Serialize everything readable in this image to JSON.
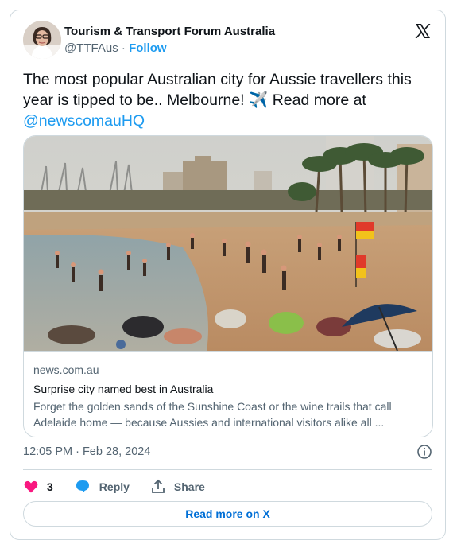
{
  "author": {
    "name": "Tourism & Transport Forum Australia",
    "handle": "@TTFAus",
    "separator": "·",
    "follow_label": "Follow"
  },
  "tweet": {
    "text_part1": "The most popular Australian city for Aussie travellers this year is tipped to be.. Melbourne! ",
    "emoji": "✈️",
    "text_part2": " Read more at ",
    "mention": "@newscomauHQ"
  },
  "link_card": {
    "image_icon": "beach-crowd-photo",
    "domain": "news.com.au",
    "title": "Surprise city named best in Australia",
    "description": "Forget the golden sands of the Sunshine Coast or the wine trails that call Adelaide home — because Aussies and international visitors alike all ..."
  },
  "timestamp": "12:05 PM · Feb 28, 2024",
  "actions": {
    "likes_count": "3",
    "reply_label": "Reply",
    "share_label": "Share",
    "read_more_label": "Read more on X"
  },
  "colors": {
    "accent": "#1d9bf0",
    "like": "#f91880",
    "text": "#0f1419",
    "muted": "#536471",
    "border": "#cfd9de"
  }
}
